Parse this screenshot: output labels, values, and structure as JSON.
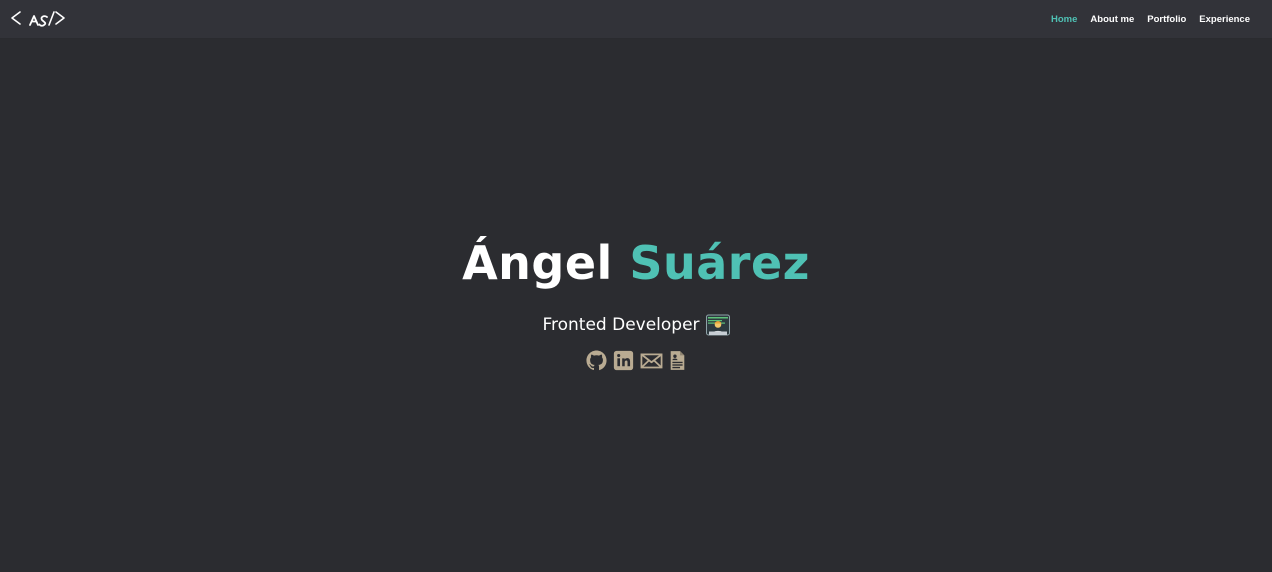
{
  "navbar": {
    "logo_icon": "as-code-logo-icon",
    "links": [
      {
        "label": "Home",
        "active": true
      },
      {
        "label": "About me",
        "active": false
      },
      {
        "label": "Portfolio",
        "active": false
      },
      {
        "label": "Experience",
        "active": false
      }
    ]
  },
  "hero": {
    "first_name": "Ángel",
    "last_name": "Suárez",
    "role": "Fronted Developer",
    "role_emoji": "technologist-emoji",
    "social": [
      {
        "icon": "github-icon"
      },
      {
        "icon": "linkedin-icon"
      },
      {
        "icon": "mail-icon"
      },
      {
        "icon": "resume-icon"
      }
    ]
  },
  "colors": {
    "background": "#2b2c30",
    "navbar": "#323339",
    "accent": "#4fc1b4",
    "icon": "#b9ab92",
    "text": "#ffffff"
  }
}
